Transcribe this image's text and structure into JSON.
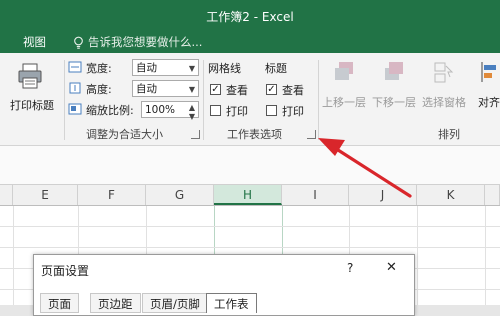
{
  "window": {
    "title": "工作簿2 - Excel"
  },
  "menu": {
    "view_tab": "视图",
    "tell_me": "告诉我您想要做什么..."
  },
  "ribbon": {
    "print_titles": "打印标题",
    "scale_to_fit": {
      "width_label": "宽度:",
      "width_value": "自动",
      "height_label": "高度:",
      "height_value": "自动",
      "scale_label": "缩放比例:",
      "scale_value": "100%",
      "group_label": "调整为合适大小"
    },
    "sheet_options": {
      "gridlines_label": "网格线",
      "headings_label": "标题",
      "view_label": "查看",
      "print_label": "打印",
      "gridlines_view_checked": true,
      "gridlines_print_checked": false,
      "headings_view_checked": true,
      "headings_print_checked": false,
      "group_label": "工作表选项"
    },
    "arrange": {
      "bring_forward": "上移一层",
      "send_backward": "下移一层",
      "selection_pane": "选择窗格",
      "align": "对齐",
      "group_label": "排列"
    }
  },
  "grid": {
    "columns": [
      "E",
      "F",
      "G",
      "H",
      "I",
      "J",
      "K"
    ],
    "selected_column": "H"
  },
  "dialog": {
    "title": "页面设置",
    "help": "?",
    "close": "✕",
    "tabs": [
      "页面",
      "页边距",
      "页眉/页脚",
      "工作表"
    ],
    "active_tab": "工作表"
  },
  "annotation": {
    "color": "#d9262b"
  }
}
